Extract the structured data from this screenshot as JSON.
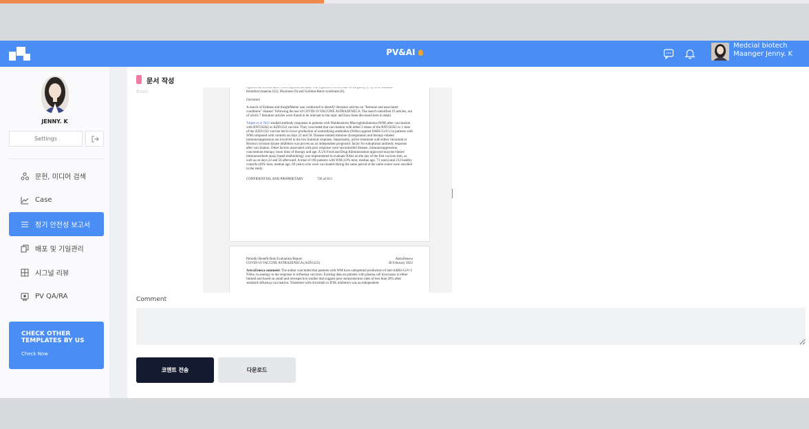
{
  "header": {
    "brand": "PV&AI",
    "user_org": "Medcial biotech",
    "user_role": "Maanger Jenny. K",
    "colors": {
      "accent": "#4a8df5",
      "flame": "#f7a428"
    }
  },
  "sidebar": {
    "username": "JENNY. K",
    "settings_label": "Settings",
    "items": [
      {
        "label": "문헌, 미디어 검색",
        "icon": "share-nodes-icon",
        "active": false
      },
      {
        "label": "Case",
        "icon": "line-chart-icon",
        "active": false
      },
      {
        "label": "정기 안전성 보고서",
        "icon": "menu-lines-icon",
        "active": true
      },
      {
        "label": "배포 및 기일관리",
        "icon": "copy-icon",
        "active": false
      },
      {
        "label": "시그널 리뷰",
        "icon": "grid-icon",
        "active": false
      },
      {
        "label": "PV QA/RA",
        "icon": "badge-icon",
        "active": false
      }
    ],
    "promo": {
      "title": "CHECK OTHER TEMPLATES BY US",
      "link": "Check Now"
    }
  },
  "main": {
    "section_title": "문서 작성",
    "basic_label": "Basic",
    "document": {
      "page1": {
        "para_top": "reported as serious and 6 were reported as fatal. The reported PTs in order of frequency (>5) were Immune thrombocytopenia (12), Dizziness (9) and Guillain-Barre syndrome (6).",
        "lit_heading": "Literature",
        "lit_para": "A search of Embase and InsightMeme was conducted to identify literature articles on \"Immune and associated conditions\" disease\" following the use of COVID-19 VACCINE ASTRAZENECA. The search identified 19 articles, out of which 7 literature articles were found to be relevant to the topic and have been discussed here in detail.",
        "ref_link": "Tarpes et al 2021",
        "ref_para": "studied antibody responses in patients with Waldenstrom Macroglobulinemia (WM) after vaccination with BNT162b2 or AZD1222 vaccine. They concluded that vaccination with either 2 doses of the BNT162b2 or 1 dose of the AZD1222 vaccine led to lower production of neutralizing antibodies (NAbs) against SARS-CoV-2 in patients with WM compared with controls on days 22 and 50. Disease-related immune dysregulation and therapy-related immunosuppression are involved in the low humoral response. Importantly, active treatment with either rituximab or Bruton's tyrosine kinase inhibitors was proven as an independent prognostic factor for suboptimal antibody response after vaccination. Other factors associated with poor response were uncontrolled disease, immunosuppression, concomitant therapy, more lines of therapy and age. A US Food and Drug Administration-approved enzyme-linked immunosorbent assay-based methodology was implemented to evaluate NAbs on the day of the first vaccine shot, as well as on days 22 and 50 afterward. A total of 106 patients with WM (43% men; median age, 73 years) and 212 healthy controls (40% men; median age, 69 years) who were vaccinated during the same period at the same centre were enrolled in the study.",
        "footer_left": "CONFIDENTIAL AND PROPRIETARY",
        "footer_right": "726 of 813"
      },
      "page2": {
        "header_left_1": "Periodic Benefit Risk Evaluation Report",
        "header_left_2": "COVID-19 VACCINE ASTRAZENECA (AZD1222)",
        "header_right_1": "AstraZeneca",
        "header_right_2": "28 February 2022",
        "comment_bold": "AstraZeneca comment:",
        "comment_text": "The author concluded that patients with WM have suboptimal production of anti-SARS-CoV-2 NAbs, in analogy to the response to influenza vaccines. Existing data on patients with plasma cell dyscrasias is either limited and based on small and retrospective studies that suggest poor seroprotection rates of less than 20% after standard influenza vaccination. Treatment with rituximab or BTK inhibitors was an independent"
      }
    },
    "comment_label": "Comment",
    "comment_value": "",
    "send_button": "코멘트 전송",
    "download_button": "다운로드"
  }
}
